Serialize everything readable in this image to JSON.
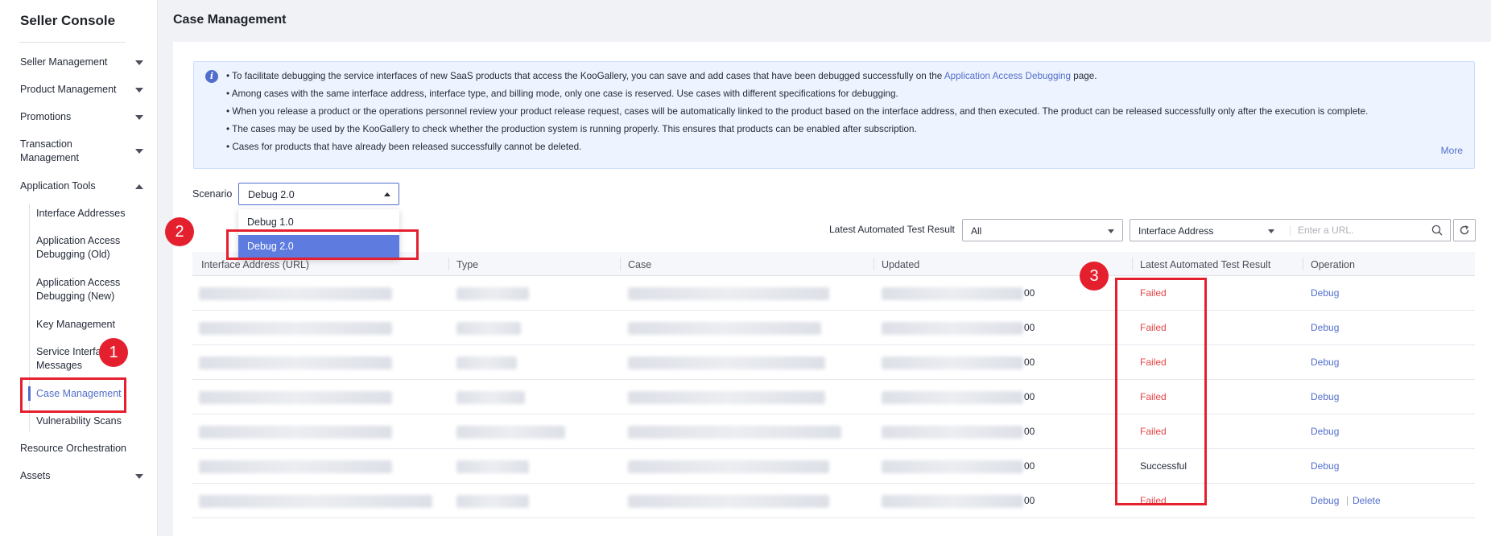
{
  "sidebar": {
    "title": "Seller Console",
    "items": [
      {
        "label": "Seller Management",
        "arrow": "down"
      },
      {
        "label": "Product Management",
        "arrow": "down"
      },
      {
        "label": "Promotions",
        "arrow": "down"
      },
      {
        "label": "Transaction Management",
        "arrow": "down"
      },
      {
        "label": "Application Tools",
        "arrow": "up"
      },
      {
        "label": "Resource Orchestration"
      },
      {
        "label": "Assets",
        "arrow": "down"
      }
    ],
    "app_tools_sub": [
      "Interface Addresses",
      "Application Access Debugging (Old)",
      "Application Access Debugging (New)",
      "Key Management",
      "Service Interface Messages",
      "Case Management",
      "Vulnerability Scans"
    ],
    "active_sub": "Case Management"
  },
  "page": {
    "title": "Case Management"
  },
  "notice": {
    "lines": [
      {
        "prefix": "• To facilitate debugging the service interfaces of new SaaS products that access the KooGallery, you can save and add cases that have been debugged successfully on the ",
        "link": "Application Access Debugging",
        "suffix": " page."
      },
      {
        "text": "• Among cases with the same interface address, interface type, and billing mode, only one case is reserved. Use cases with different specifications for debugging."
      },
      {
        "text": "• When you release a product or the operations personnel review your product release request, cases will be automatically linked to the product based on the interface address, and then executed. The product can be released successfully only after the execution is complete."
      },
      {
        "text": "• The cases may be used by the KooGallery to check whether the production system is running properly. This ensures that products can be enabled after subscription."
      },
      {
        "text": "• Cases for products that have already been released successfully cannot be deleted."
      }
    ],
    "more": "More"
  },
  "scenario": {
    "label": "Scenario",
    "value": "Debug 2.0",
    "options": [
      "Debug 1.0",
      "Debug 2.0"
    ]
  },
  "filters": {
    "latest_label": "Latest Automated Test Result",
    "latest_value": "All",
    "address_type": "Interface Address",
    "search_placeholder": "Enter a URL."
  },
  "table": {
    "headers": [
      "Interface Address (URL)",
      "Type",
      "Case",
      "Updated",
      "Latest Automated Test Result",
      "Operation"
    ],
    "rows": [
      {
        "updated_frag": "00",
        "result": "Failed",
        "status": "failed",
        "ops": [
          "Debug"
        ]
      },
      {
        "updated_frag": "00",
        "result": "Failed",
        "status": "failed",
        "ops": [
          "Debug"
        ]
      },
      {
        "updated_frag": "00",
        "result": "Failed",
        "status": "failed",
        "ops": [
          "Debug"
        ]
      },
      {
        "updated_frag": "00",
        "result": "Failed",
        "status": "failed",
        "ops": [
          "Debug"
        ]
      },
      {
        "updated_frag": "00",
        "result": "Failed",
        "status": "failed",
        "ops": [
          "Debug"
        ]
      },
      {
        "updated_frag": "00",
        "result": "Successful",
        "status": "ok",
        "ops": [
          "Debug"
        ]
      },
      {
        "updated_frag": "00",
        "result": "Failed",
        "status": "failed",
        "ops": [
          "Debug",
          "Delete"
        ]
      }
    ]
  },
  "annotations": [
    "1",
    "2",
    "3"
  ],
  "colors": {
    "accent": "#526ecc",
    "failed": "#e54545",
    "annotation": "#e5202e"
  }
}
